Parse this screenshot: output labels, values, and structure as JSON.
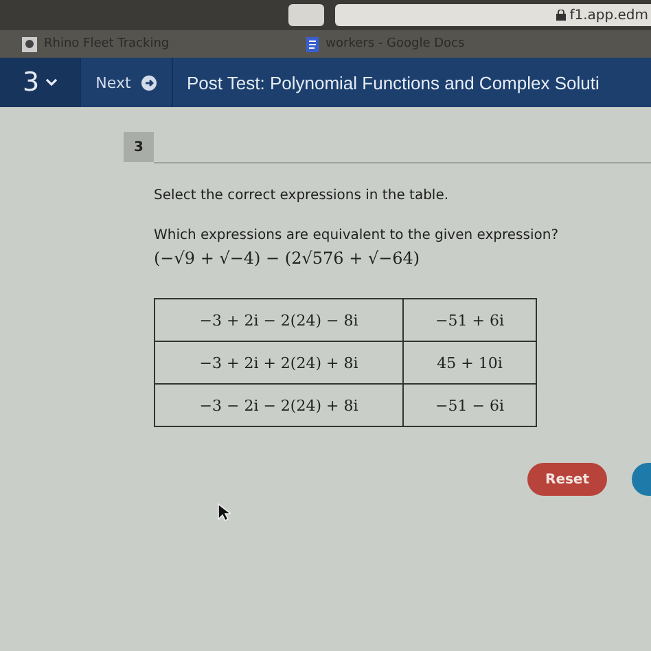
{
  "browser": {
    "address": "f1.app.edm",
    "bookmarks": [
      {
        "label": "Rhino Fleet Tracking",
        "kind": "site"
      },
      {
        "label": "workers - Google Docs",
        "kind": "doc"
      }
    ]
  },
  "nav": {
    "question_number": "3",
    "next_label": "Next",
    "title": "Post Test: Polynomial Functions and Complex Soluti"
  },
  "question": {
    "number": "3",
    "instruction": "Select the correct expressions in the table.",
    "prompt": "Which expressions are equivalent to the given expression?",
    "expression": "(−√9 + √−4) − (2√576 + √−64)"
  },
  "table": {
    "rows": [
      [
        {
          "text": "−3 + 2i − 2(24) − 8i",
          "selected": false
        },
        {
          "text": "−51 + 6i",
          "selected": false
        }
      ],
      [
        {
          "text": "−3 + 2i + 2(24) + 8i",
          "selected": false
        },
        {
          "text": "45 + 10i",
          "selected": false
        }
      ],
      [
        {
          "text": "−3 − 2i − 2(24) + 8i",
          "selected": false
        },
        {
          "text": "−51 − 6i",
          "selected": false
        }
      ]
    ]
  },
  "buttons": {
    "reset": "Reset"
  }
}
